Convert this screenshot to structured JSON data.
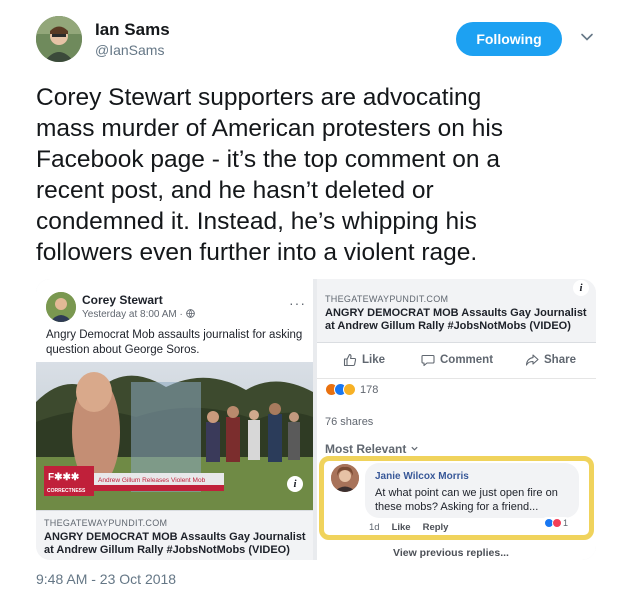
{
  "tweet": {
    "author_name": "Ian Sams",
    "author_handle": "@IanSams",
    "follow_label": "Following",
    "text": "Corey Stewart supporters are advocating\nmass murder of American protesters on his\nFacebook page - it’s the top comment on a\nrecent post, and he hasn’t deleted or\ncondemned it. Instead, he’s whipping his\nfollowers even further into a violent rage.",
    "timestamp": "9:48 AM - 23 Oct 2018"
  },
  "fb_post": {
    "author": "Corey Stewart",
    "time": "Yesterday at 8:00 AM · ",
    "caption": "Angry Democrat Mob assaults journalist for asking question about George Soros.",
    "more": "···",
    "video_banner": "F✱✱✱",
    "video_banner_sub": "CORRECTNESS",
    "video_lower_third": "Andrew Gillum Releases Violent Mob",
    "link_domain": "THEGATEWAYPUNDIT.COM",
    "link_title": "ANGRY DEMOCRAT MOB Assaults Gay Journalist at Andrew Gillum Rally #JobsNotMobs (VIDEO)",
    "info": "i"
  },
  "fb_comments": {
    "link_domain": "THEGATEWAYPUNDIT.COM",
    "link_title": "ANGRY DEMOCRAT MOB Assaults Gay Journalist at Andrew Gillum Rally #JobsNotMobs (VIDEO)",
    "info": "i",
    "like_label": "Like",
    "comment_label": "Comment",
    "share_label": "Share",
    "reaction_count": "178",
    "shares": "76 shares",
    "sort_label": "Most Relevant",
    "comment": {
      "author": "Janie Wilcox Morris",
      "text": "At what point can we just open fire on these mobs? Asking for a friend...",
      "age": "1d",
      "like": "Like",
      "reply": "Reply",
      "react_count": "1"
    },
    "view_previous": "View previous replies..."
  },
  "colors": {
    "follow_button": "#1da1f2",
    "highlight": "#f0d35c",
    "fb_blue": "#385898"
  }
}
